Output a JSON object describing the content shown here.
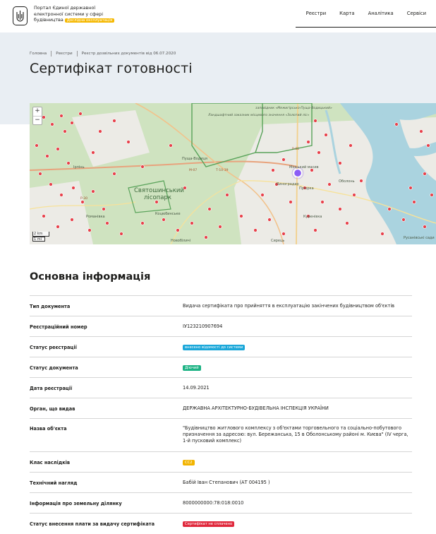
{
  "header": {
    "brand_line1": "Портал Єдиної державної",
    "brand_line2": "електронної системи у сфері",
    "brand_line3": "будівництва",
    "pilot_badge": "Дослідна експлуатація",
    "nav": [
      "Реєстри",
      "Карта",
      "Аналітика",
      "Сервіси"
    ]
  },
  "breadcrumb": [
    "Головна",
    "Реєстри",
    "Реєстр дозвільних документів від 06.07.2020"
  ],
  "page_title": "Сертифікат готовності",
  "map": {
    "zoom_in": "+",
    "zoom_out": "−",
    "scale_km": "2 km",
    "scale_mi": "1 mi",
    "labels": {
      "sviatoshynskyi": "Святошинський",
      "lisopark": "лісопарк",
      "pushcha": "Пуща-Водиця",
      "irpin": "Ірпінь",
      "romanivka": "Романівка",
      "kotsiubynske": "Коцюбинське",
      "novobilychi": "Новобіличі",
      "vynohradar": "Виноградар",
      "minskyi": "Мінський масив",
      "obolon": "Оболонь",
      "priorka": "Пріорка",
      "kurenivka": "Куренівка",
      "syrets": "Сирець",
      "rusanivski": "Русанівські сади",
      "zolotyi": "Ландшафтний заказник місцевого значення «Золотий ліс»",
      "mezhyhirsko": "заповідник «Межигірсько-Пуща-Водицький»",
      "m07": "М-07",
      "t1039": "Т-10-39",
      "p02": "Р-02",
      "p30": "Р-30"
    }
  },
  "section_title": "Основна інформація",
  "rows": [
    {
      "key": "Тип документа",
      "value": "Видача сертифіката про прийняття в експлуатацію закінчених будівництвом об'єктів"
    },
    {
      "key": "Реєстраційний номер",
      "value": "ІУ123210907694"
    },
    {
      "key": "Статус реєстрації",
      "pill": "внесено відомості до системи",
      "pill_color": "#1aa7d9"
    },
    {
      "key": "Статус документа",
      "pill": "Діючий",
      "pill_color": "#1db384"
    },
    {
      "key": "Дата реєстрації",
      "value": "14.09.2021"
    },
    {
      "key": "Орган, що видав",
      "value": "ДЕРЖАВНА АРХІТЕКТУРНО-БУДІВЕЛЬНА ІНСПЕКЦІЯ УКРАЇНИ"
    },
    {
      "key": "Назва об'єкта",
      "value": "\"Будівництво житлового комплексу з об'єктами торговельного та соціально-побутового призначення за адресою: вул. Бережанська, 15 в Оболонському районі м. Києва\" (IV черга, 1-й пусковий комплекс)"
    },
    {
      "key": "Клас наслідків",
      "pill": "СС2",
      "pill_color": "#f2b400"
    },
    {
      "key": "Технічний нагляд",
      "value": "Бабій Іван Степанович (АТ 004195 )"
    },
    {
      "key": "Інформація про земельну ділянку",
      "value": "8000000000:78:018:0010"
    },
    {
      "key": "Статус внесення плати за видачу сертифіката",
      "pill": "Сертифікат не сплачено",
      "pill_color": "#e0283c"
    }
  ],
  "colors": {
    "accent": "#f5b800",
    "hero_bg": "#e9eef3",
    "map_green": "#cfe3c0",
    "marker": "#e8414b"
  }
}
